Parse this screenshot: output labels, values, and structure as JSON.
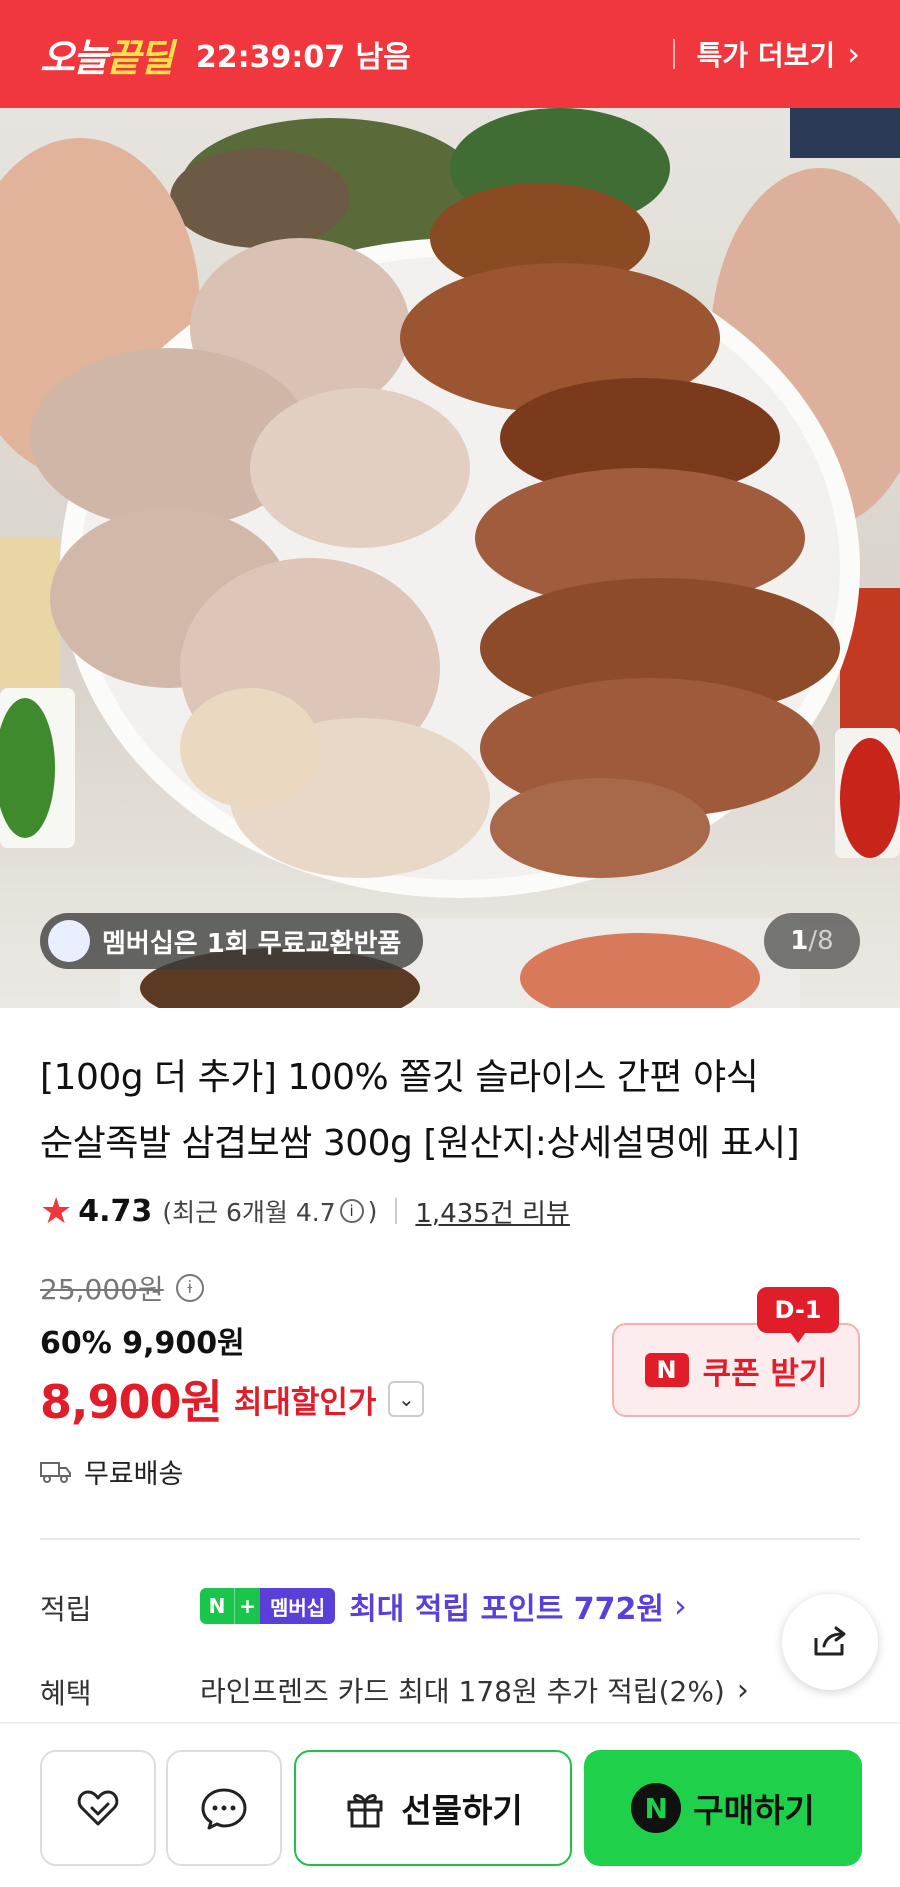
{
  "deal_bar": {
    "logo_prefix": "오늘",
    "logo_highlight": "끝딜",
    "timer": "22:39:07 남음",
    "more_label": "특가 더보기"
  },
  "hero": {
    "member_pill": "멤버십은 1회 무료교환반품",
    "page_current": "1",
    "page_total": "/8"
  },
  "product": {
    "title_line1": "[100g 더 추가] 100% 쫄깃 슬라이스 간편 야식",
    "title_line2": "순살족발 삼겹보쌈 300g [원산지:상세설명에 표시]",
    "rating_score": "4.73",
    "rating_recent": "(최근 6개월 4.7",
    "rating_recent_close": ")",
    "reviews": "1,435건 리뷰"
  },
  "price": {
    "original": "25,000원",
    "sale": "60% 9,900원",
    "max_amount": "8,900원",
    "max_label": "최대할인가",
    "coupon_label": "쿠폰 받기",
    "coupon_badge": "N",
    "dday": "D-1"
  },
  "shipping": {
    "label": "무료배송"
  },
  "rows": {
    "points_label": "적립",
    "membership_badge": "멤버십",
    "points_text": "최대 적립 포인트 772원",
    "benefit_label": "혜택",
    "benefit_text": "라인프렌즈 카드 최대 178원 추가 적립(2%)"
  },
  "bottom": {
    "gift_label": "선물하기",
    "buy_label": "구매하기",
    "buy_logo": "N"
  },
  "colors": {
    "brand_red": "#f0373d",
    "price_red": "#e11d2a",
    "naver_green": "#1fd04b",
    "membership_purple": "#5b3fd9"
  }
}
